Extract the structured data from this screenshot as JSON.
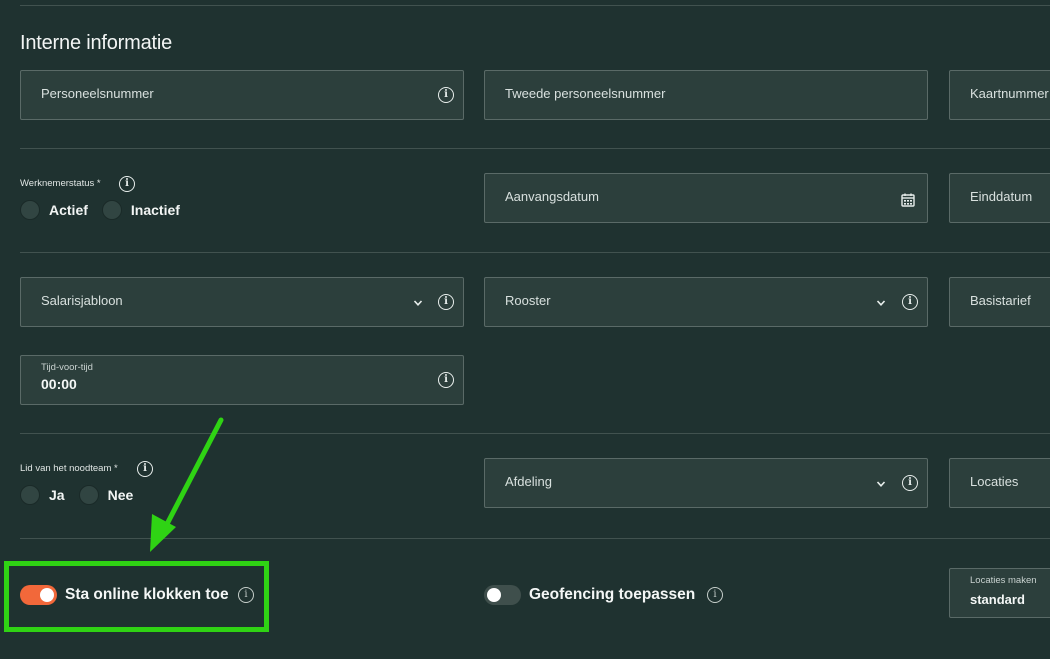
{
  "section": {
    "title": "Interne informatie"
  },
  "fields": {
    "personeelsnummer": "Personeelsnummer",
    "tweede_personeelsnummer": "Tweede personeelsnummer",
    "kaartnummer": "Kaartnummer",
    "aanvangsdatum": "Aanvangsdatum",
    "einddatum": "Einddatum",
    "salarisjabloon": "Salarisjabloon",
    "rooster": "Rooster",
    "basistarief": "Basistarief",
    "afdeling": "Afdeling",
    "locaties": "Locaties",
    "tijd_voor_tijd": {
      "label": "Tijd-voor-tijd",
      "value": "00:00"
    },
    "locaties_maken": {
      "label": "Locaties maken",
      "value": "standard"
    }
  },
  "werknemerstatus": {
    "label": "Werknemerstatus *",
    "options": [
      "Actief",
      "Inactief"
    ]
  },
  "noodteam": {
    "label": "Lid van het noodteam *",
    "options": [
      "Ja",
      "Nee"
    ]
  },
  "toggles": {
    "online_klokken": {
      "label": "Sta online klokken toe",
      "on": true
    },
    "geofencing": {
      "label": "Geofencing toepassen",
      "on": false
    }
  },
  "colors": {
    "background": "#1f3230",
    "field": "#2c3f3c",
    "toggle_on": "#f2683a",
    "toggle_off": "#3f4f4c",
    "annotation": "#2fd314"
  },
  "icons": [
    "info-icon",
    "chevron-down-icon",
    "calendar-icon",
    "annotation-arrow"
  ]
}
